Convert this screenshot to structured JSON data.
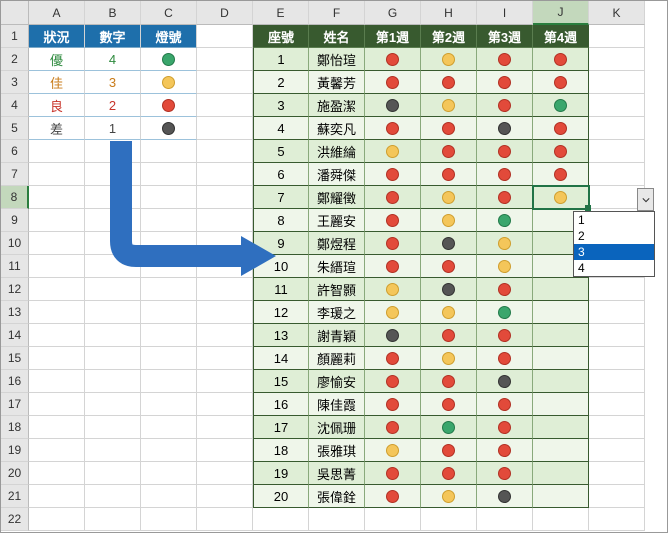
{
  "columns": [
    "A",
    "B",
    "C",
    "D",
    "E",
    "F",
    "G",
    "H",
    "I",
    "J",
    "K"
  ],
  "rows": [
    "1",
    "2",
    "3",
    "4",
    "5",
    "6",
    "7",
    "8",
    "9",
    "10",
    "11",
    "12",
    "13",
    "14",
    "15",
    "16",
    "17",
    "18",
    "19",
    "20",
    "21",
    "22"
  ],
  "left": {
    "headers": [
      "狀況",
      "數字",
      "燈號"
    ],
    "rows": [
      {
        "status": "優",
        "num": "4",
        "dot": "g"
      },
      {
        "status": "佳",
        "num": "3",
        "dot": "y"
      },
      {
        "status": "良",
        "num": "2",
        "dot": "r"
      },
      {
        "status": "差",
        "num": "1",
        "dot": "k"
      }
    ]
  },
  "right": {
    "headers": [
      "座號",
      "姓名",
      "第1週",
      "第2週",
      "第3週",
      "第4週"
    ],
    "rows": [
      {
        "id": "1",
        "name": "鄭怡瑄",
        "w": [
          "r",
          "y",
          "r",
          "r"
        ]
      },
      {
        "id": "2",
        "name": "黃馨芳",
        "w": [
          "r",
          "r",
          "r",
          "r"
        ]
      },
      {
        "id": "3",
        "name": "施盈潔",
        "w": [
          "k",
          "y",
          "r",
          "g"
        ]
      },
      {
        "id": "4",
        "name": "蘇奕凡",
        "w": [
          "r",
          "r",
          "k",
          "r"
        ]
      },
      {
        "id": "5",
        "name": "洪維綸",
        "w": [
          "y",
          "r",
          "r",
          "r"
        ]
      },
      {
        "id": "6",
        "name": "潘舜傑",
        "w": [
          "r",
          "r",
          "r",
          "r"
        ]
      },
      {
        "id": "7",
        "name": "鄭耀徵",
        "w": [
          "r",
          "y",
          "r",
          "y"
        ]
      },
      {
        "id": "8",
        "name": "王麗安",
        "w": [
          "r",
          "y",
          "g",
          ""
        ]
      },
      {
        "id": "9",
        "name": "鄭煜程",
        "w": [
          "r",
          "k",
          "y",
          ""
        ]
      },
      {
        "id": "10",
        "name": "朱縉瑄",
        "w": [
          "r",
          "r",
          "y",
          ""
        ]
      },
      {
        "id": "11",
        "name": "許智顥",
        "w": [
          "y",
          "k",
          "r",
          ""
        ]
      },
      {
        "id": "12",
        "name": "李瑗之",
        "w": [
          "y",
          "y",
          "g",
          ""
        ]
      },
      {
        "id": "13",
        "name": "謝青穎",
        "w": [
          "k",
          "r",
          "r",
          ""
        ]
      },
      {
        "id": "14",
        "name": "顏麗莉",
        "w": [
          "r",
          "y",
          "r",
          ""
        ]
      },
      {
        "id": "15",
        "name": "廖愉安",
        "w": [
          "r",
          "r",
          "k",
          ""
        ]
      },
      {
        "id": "16",
        "name": "陳佳霞",
        "w": [
          "r",
          "r",
          "r",
          ""
        ]
      },
      {
        "id": "17",
        "name": "沈佩珊",
        "w": [
          "r",
          "g",
          "r",
          ""
        ]
      },
      {
        "id": "18",
        "name": "張雅琪",
        "w": [
          "y",
          "r",
          "r",
          ""
        ]
      },
      {
        "id": "19",
        "name": "吳思菁",
        "w": [
          "r",
          "r",
          "r",
          ""
        ]
      },
      {
        "id": "20",
        "name": "張偉銓",
        "w": [
          "r",
          "y",
          "k",
          ""
        ]
      }
    ]
  },
  "dropdown": {
    "items": [
      "1",
      "2",
      "3",
      "4"
    ],
    "highlight": 2
  },
  "selectedCell": "J8",
  "selectedCol": 9,
  "selectedRow": 7,
  "colors": {
    "green": "#3aa66c",
    "yellow": "#f4c65a",
    "red": "#e24a3a",
    "dark": "#555"
  }
}
